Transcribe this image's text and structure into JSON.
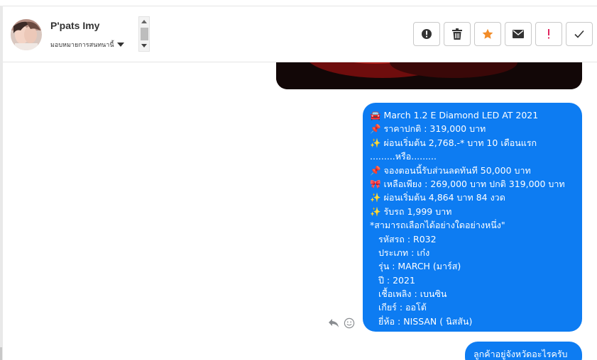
{
  "header": {
    "contact_name": "P'pats Imy",
    "assign_label": "มอบหมายการสนทนานี้",
    "actions": [
      {
        "name": "report-spam",
        "icon": "exclamation-circle-icon"
      },
      {
        "name": "delete",
        "icon": "trash-icon"
      },
      {
        "name": "star",
        "icon": "star-icon",
        "color": "#f28c28"
      },
      {
        "name": "mark-unread",
        "icon": "envelope-icon"
      },
      {
        "name": "flag-important",
        "icon": "exclamation-icon",
        "color": "#e0245e"
      },
      {
        "name": "mark-done",
        "icon": "check-icon"
      }
    ]
  },
  "colors": {
    "bubble": "#0d7cf2",
    "header_border": "#e5e5e5"
  },
  "message": {
    "lines": [
      "🚘 March 1.2 E Diamond LED AT 2021",
      "📌 ราคาปกติ : 319,000 บาท",
      "✨ ผ่อนเริ่มต้น 2,768.-* บาท 10 เดือนแรก",
      ".........หรือ.........",
      "📌 จองตอนนี้รับส่วนลดทันที 50,000 บาท",
      "🎀 เหลือเพียง : 269,000 บาท ปกติ 319,000 บาท",
      "✨ ผ่อนเริ่มต้น 4,864 บาท 84 งวด",
      "✨ รับรถ 1,999 บาท",
      "*สามารถเลือกได้อย่างใดอย่างหนึ่ง\"",
      "รหัสรถ : R032",
      "ประเภท : เก๋ง",
      "รุ่น : MARCH (มาร์ส)",
      "ปี : 2021",
      "เชื้อเพลิง : เบนซิน",
      "เกียร์ : ออโต้",
      "ยี่ห้อ : NISSAN ( นิสสัน)"
    ]
  },
  "next_message": {
    "text": "ลูกค้าอยู่จังหวัดอะไรครับ"
  }
}
